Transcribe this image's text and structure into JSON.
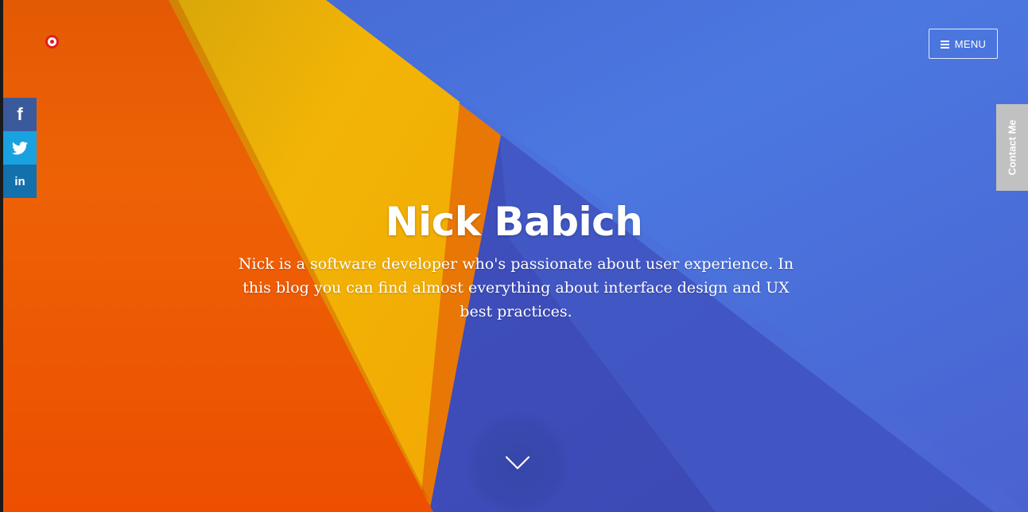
{
  "header": {
    "logo_icon": "target-icon",
    "menu": {
      "label": "MENU",
      "icon": "hamburger-icon"
    }
  },
  "social": [
    {
      "name": "facebook",
      "glyph": "f",
      "color": "#3b5a9b"
    },
    {
      "name": "twitter",
      "icon": "twitter-bird-icon",
      "color": "#1aa1e0"
    },
    {
      "name": "linkedin",
      "glyph": "in",
      "color": "#1370ab"
    }
  ],
  "contact_tab": {
    "label": "Contact Me"
  },
  "hero": {
    "title": "Nick Babich",
    "description": "Nick is a software developer who's passionate about user experience. In this blog you can find almost everything about interface design and UX best practices.",
    "scroll_icon": "chevron-down-icon"
  },
  "colors": {
    "orange": "#ec5a05",
    "yellow": "#f0b308",
    "blue": "#4a6fd8",
    "dark_blue": "#3b4fc2"
  }
}
